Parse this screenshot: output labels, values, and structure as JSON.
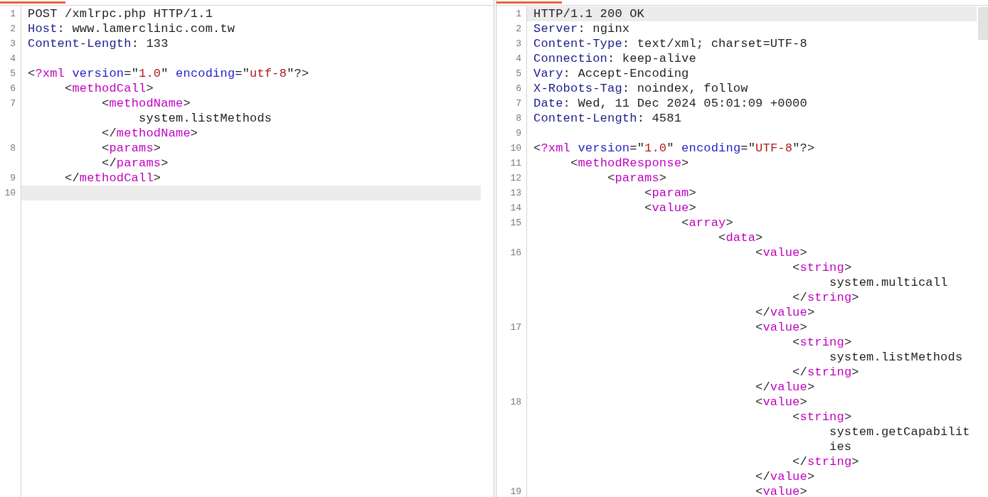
{
  "panes": [
    {
      "lines": [
        {
          "number": "1",
          "selected": false,
          "wraps": [
            {
              "spans": [
                {
                  "kind": "text",
                  "text": "POST /xmlrpc.php HTTP/1.1"
                }
              ]
            }
          ]
        },
        {
          "number": "2",
          "selected": false,
          "wraps": [
            {
              "spans": [
                {
                  "kind": "header",
                  "text": "Host"
                },
                {
                  "kind": "text",
                  "text": ": www.lamerclinic.com.tw"
                }
              ]
            }
          ]
        },
        {
          "number": "3",
          "selected": false,
          "wraps": [
            {
              "spans": [
                {
                  "kind": "header",
                  "text": "Content-Length"
                },
                {
                  "kind": "text",
                  "text": ": 133"
                }
              ]
            }
          ]
        },
        {
          "number": "4",
          "selected": false
        },
        {
          "number": "5",
          "selected": false,
          "wraps": [
            {
              "spans": [
                {
                  "kind": "text",
                  "text": "<"
                },
                {
                  "kind": "tag",
                  "text": "?xml"
                },
                {
                  "kind": "attr",
                  "text": " version"
                },
                {
                  "kind": "text",
                  "text": "=\""
                },
                {
                  "kind": "value",
                  "text": "1.0"
                },
                {
                  "kind": "text",
                  "text": "\" "
                },
                {
                  "kind": "attr",
                  "text": "encoding"
                },
                {
                  "kind": "text",
                  "text": "=\""
                },
                {
                  "kind": "value",
                  "text": "utf-8"
                },
                {
                  "kind": "text",
                  "text": "\"?>"
                }
              ]
            }
          ]
        },
        {
          "number": "6",
          "selected": false,
          "wraps": [
            {
              "spans": [
                {
                  "kind": "text",
                  "text": "     <"
                },
                {
                  "kind": "tag",
                  "text": "methodCall"
                },
                {
                  "kind": "text",
                  "text": ">"
                }
              ]
            }
          ]
        },
        {
          "number": "7",
          "selected": false,
          "wraps": [
            {
              "spans": [
                {
                  "kind": "text",
                  "text": "          <"
                },
                {
                  "kind": "tag",
                  "text": "methodName"
                },
                {
                  "kind": "text",
                  "text": ">"
                }
              ]
            },
            {
              "spans": [
                {
                  "kind": "text",
                  "text": "               system.listMethods"
                }
              ]
            },
            {
              "spans": [
                {
                  "kind": "text",
                  "text": "          </"
                },
                {
                  "kind": "tag",
                  "text": "methodName"
                },
                {
                  "kind": "text",
                  "text": ">"
                }
              ]
            }
          ]
        },
        {
          "number": "8",
          "selected": false,
          "wraps": [
            {
              "spans": [
                {
                  "kind": "text",
                  "text": "          <"
                },
                {
                  "kind": "tag",
                  "text": "params"
                },
                {
                  "kind": "text",
                  "text": ">"
                }
              ]
            },
            {
              "spans": [
                {
                  "kind": "text",
                  "text": "          </"
                },
                {
                  "kind": "tag",
                  "text": "params"
                },
                {
                  "kind": "text",
                  "text": ">"
                }
              ]
            }
          ]
        },
        {
          "number": "9",
          "selected": false,
          "wraps": [
            {
              "spans": [
                {
                  "kind": "text",
                  "text": "     </"
                },
                {
                  "kind": "tag",
                  "text": "methodCall"
                },
                {
                  "kind": "text",
                  "text": ">"
                }
              ]
            }
          ]
        },
        {
          "number": "10",
          "selected": true
        }
      ]
    },
    {
      "lines": [
        {
          "number": "1",
          "selected": true,
          "wraps": [
            {
              "spans": [
                {
                  "kind": "text",
                  "text": "HTTP/1.1 200 OK"
                }
              ]
            }
          ]
        },
        {
          "number": "2",
          "selected": false,
          "wraps": [
            {
              "spans": [
                {
                  "kind": "header",
                  "text": "Server"
                },
                {
                  "kind": "text",
                  "text": ": nginx"
                }
              ]
            }
          ]
        },
        {
          "number": "3",
          "selected": false,
          "wraps": [
            {
              "spans": [
                {
                  "kind": "header",
                  "text": "Content-Type"
                },
                {
                  "kind": "text",
                  "text": ": text/xml; charset=UTF-8"
                }
              ]
            }
          ]
        },
        {
          "number": "4",
          "selected": false,
          "wraps": [
            {
              "spans": [
                {
                  "kind": "header",
                  "text": "Connection"
                },
                {
                  "kind": "text",
                  "text": ": keep-alive"
                }
              ]
            }
          ]
        },
        {
          "number": "5",
          "selected": false,
          "wraps": [
            {
              "spans": [
                {
                  "kind": "header",
                  "text": "Vary"
                },
                {
                  "kind": "text",
                  "text": ": Accept-Encoding"
                }
              ]
            }
          ]
        },
        {
          "number": "6",
          "selected": false,
          "wraps": [
            {
              "spans": [
                {
                  "kind": "header",
                  "text": "X-Robots-Tag"
                },
                {
                  "kind": "text",
                  "text": ": noindex, follow"
                }
              ]
            }
          ]
        },
        {
          "number": "7",
          "selected": false,
          "wraps": [
            {
              "spans": [
                {
                  "kind": "header",
                  "text": "Date"
                },
                {
                  "kind": "text",
                  "text": ": Wed, 11 Dec 2024 05:01:09 +0000"
                }
              ]
            }
          ]
        },
        {
          "number": "8",
          "selected": false,
          "wraps": [
            {
              "spans": [
                {
                  "kind": "header",
                  "text": "Content-Length"
                },
                {
                  "kind": "text",
                  "text": ": 4581"
                }
              ]
            }
          ]
        },
        {
          "number": "9",
          "selected": false
        },
        {
          "number": "10",
          "selected": false,
          "wraps": [
            {
              "spans": [
                {
                  "kind": "text",
                  "text": "<"
                },
                {
                  "kind": "tag",
                  "text": "?xml"
                },
                {
                  "kind": "attr",
                  "text": " version"
                },
                {
                  "kind": "text",
                  "text": "=\""
                },
                {
                  "kind": "value",
                  "text": "1.0"
                },
                {
                  "kind": "text",
                  "text": "\" "
                },
                {
                  "kind": "attr",
                  "text": "encoding"
                },
                {
                  "kind": "text",
                  "text": "=\""
                },
                {
                  "kind": "value",
                  "text": "UTF-8"
                },
                {
                  "kind": "text",
                  "text": "\"?>"
                }
              ]
            }
          ]
        },
        {
          "number": "11",
          "selected": false,
          "wraps": [
            {
              "spans": [
                {
                  "kind": "text",
                  "text": "     <"
                },
                {
                  "kind": "tag",
                  "text": "methodResponse"
                },
                {
                  "kind": "text",
                  "text": ">"
                }
              ]
            }
          ]
        },
        {
          "number": "12",
          "selected": false,
          "wraps": [
            {
              "spans": [
                {
                  "kind": "text",
                  "text": "          <"
                },
                {
                  "kind": "tag",
                  "text": "params"
                },
                {
                  "kind": "text",
                  "text": ">"
                }
              ]
            }
          ]
        },
        {
          "number": "13",
          "selected": false,
          "wraps": [
            {
              "spans": [
                {
                  "kind": "text",
                  "text": "               <"
                },
                {
                  "kind": "tag",
                  "text": "param"
                },
                {
                  "kind": "text",
                  "text": ">"
                }
              ]
            }
          ]
        },
        {
          "number": "14",
          "selected": false,
          "wraps": [
            {
              "spans": [
                {
                  "kind": "text",
                  "text": "               <"
                },
                {
                  "kind": "tag",
                  "text": "value"
                },
                {
                  "kind": "text",
                  "text": ">"
                }
              ]
            }
          ]
        },
        {
          "number": "15",
          "selected": false,
          "wraps": [
            {
              "spans": [
                {
                  "kind": "text",
                  "text": "                    <"
                },
                {
                  "kind": "tag",
                  "text": "array"
                },
                {
                  "kind": "text",
                  "text": ">"
                }
              ]
            },
            {
              "spans": [
                {
                  "kind": "text",
                  "text": "                         <"
                },
                {
                  "kind": "tag",
                  "text": "data"
                },
                {
                  "kind": "text",
                  "text": ">"
                }
              ]
            }
          ]
        },
        {
          "number": "16",
          "selected": false,
          "wraps": [
            {
              "spans": [
                {
                  "kind": "text",
                  "text": "                              <"
                },
                {
                  "kind": "tag",
                  "text": "value"
                },
                {
                  "kind": "text",
                  "text": ">"
                }
              ]
            },
            {
              "spans": [
                {
                  "kind": "text",
                  "text": "                                   <"
                },
                {
                  "kind": "tag",
                  "text": "string"
                },
                {
                  "kind": "text",
                  "text": ">"
                }
              ]
            },
            {
              "spans": [
                {
                  "kind": "text",
                  "text": "                                        system.multicall"
                }
              ]
            },
            {
              "spans": [
                {
                  "kind": "text",
                  "text": "                                   </"
                },
                {
                  "kind": "tag",
                  "text": "string"
                },
                {
                  "kind": "text",
                  "text": ">"
                }
              ]
            },
            {
              "spans": [
                {
                  "kind": "text",
                  "text": "                              </"
                },
                {
                  "kind": "tag",
                  "text": "value"
                },
                {
                  "kind": "text",
                  "text": ">"
                }
              ]
            }
          ]
        },
        {
          "number": "17",
          "selected": false,
          "wraps": [
            {
              "spans": [
                {
                  "kind": "text",
                  "text": "                              <"
                },
                {
                  "kind": "tag",
                  "text": "value"
                },
                {
                  "kind": "text",
                  "text": ">"
                }
              ]
            },
            {
              "spans": [
                {
                  "kind": "text",
                  "text": "                                   <"
                },
                {
                  "kind": "tag",
                  "text": "string"
                },
                {
                  "kind": "text",
                  "text": ">"
                }
              ]
            },
            {
              "spans": [
                {
                  "kind": "text",
                  "text": "                                        system.listMethods"
                }
              ]
            },
            {
              "spans": [
                {
                  "kind": "text",
                  "text": "                                   </"
                },
                {
                  "kind": "tag",
                  "text": "string"
                },
                {
                  "kind": "text",
                  "text": ">"
                }
              ]
            },
            {
              "spans": [
                {
                  "kind": "text",
                  "text": "                              </"
                },
                {
                  "kind": "tag",
                  "text": "value"
                },
                {
                  "kind": "text",
                  "text": ">"
                }
              ]
            }
          ]
        },
        {
          "number": "18",
          "selected": false,
          "wraps": [
            {
              "spans": [
                {
                  "kind": "text",
                  "text": "                              <"
                },
                {
                  "kind": "tag",
                  "text": "value"
                },
                {
                  "kind": "text",
                  "text": ">"
                }
              ]
            },
            {
              "spans": [
                {
                  "kind": "text",
                  "text": "                                   <"
                },
                {
                  "kind": "tag",
                  "text": "string"
                },
                {
                  "kind": "text",
                  "text": ">"
                }
              ]
            },
            {
              "spans": [
                {
                  "kind": "text",
                  "text": "                                        system.getCapabilit"
                }
              ]
            },
            {
              "spans": [
                {
                  "kind": "text",
                  "text": "                                        ies"
                }
              ]
            },
            {
              "spans": [
                {
                  "kind": "text",
                  "text": "                                   </"
                },
                {
                  "kind": "tag",
                  "text": "string"
                },
                {
                  "kind": "text",
                  "text": ">"
                }
              ]
            },
            {
              "spans": [
                {
                  "kind": "text",
                  "text": "                              </"
                },
                {
                  "kind": "tag",
                  "text": "value"
                },
                {
                  "kind": "text",
                  "text": ">"
                }
              ]
            }
          ]
        },
        {
          "number": "19",
          "selected": false,
          "wraps": [
            {
              "spans": [
                {
                  "kind": "text",
                  "text": "                              <"
                },
                {
                  "kind": "tag",
                  "text": "value"
                },
                {
                  "kind": "text",
                  "text": ">"
                }
              ]
            }
          ]
        }
      ]
    }
  ]
}
